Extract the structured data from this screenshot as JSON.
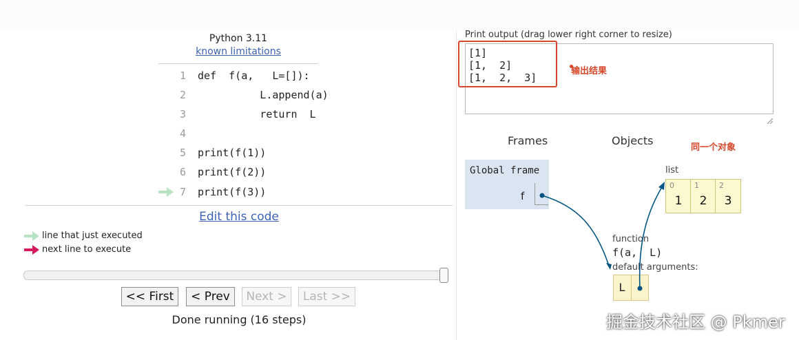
{
  "header": {
    "python_version": "Python 3.11",
    "known_limitations": "known limitations"
  },
  "code": {
    "lines": [
      {
        "num": "1",
        "text": "def  f(a,   L=[]):"
      },
      {
        "num": "2",
        "text": "          L.append(a)"
      },
      {
        "num": "3",
        "text": "          return  L"
      },
      {
        "num": "4",
        "text": ""
      },
      {
        "num": "5",
        "text": "print(f(1))"
      },
      {
        "num": "6",
        "text": "print(f(2))"
      },
      {
        "num": "7",
        "text": "print(f(3))"
      }
    ],
    "current_line": 7
  },
  "edit_link": "Edit this code",
  "legend": {
    "executed": "line that just executed",
    "next": "next line to execute"
  },
  "controls": {
    "first": "<< First",
    "prev": "< Prev",
    "next": "Next >",
    "last": "Last >>",
    "status": "Done running (16 steps)",
    "progress": {
      "step": 16,
      "total": 16
    }
  },
  "print_output": {
    "label": "Print output (drag lower right corner to resize)",
    "lines": [
      "[1]",
      "[1,  2]",
      "[1,  2,  3]"
    ]
  },
  "annotations": {
    "output_result": "输出结果",
    "same_object": "同一个对象"
  },
  "visualization": {
    "frames_heading": "Frames",
    "objects_heading": "Objects",
    "global_frame": {
      "title": "Global frame",
      "var": "f"
    },
    "list_object": {
      "label": "list",
      "indices": [
        "0",
        "1",
        "2"
      ],
      "values": [
        "1",
        "2",
        "3"
      ]
    },
    "function_object": {
      "label": "function",
      "signature": "f(a,  L)",
      "defaults_label": "default arguments:",
      "default_name": "L"
    }
  },
  "watermark": "掘金技术社区 @ Pkmer",
  "colors": {
    "link": "#3d63b5",
    "arrow_executed": "#b7e3c3",
    "arrow_next": "#d6185e",
    "annotation": "#d9472b",
    "frame_bg": "#dbe5f1",
    "list_bg": "#fbf9d0",
    "pointer": "#005583"
  }
}
